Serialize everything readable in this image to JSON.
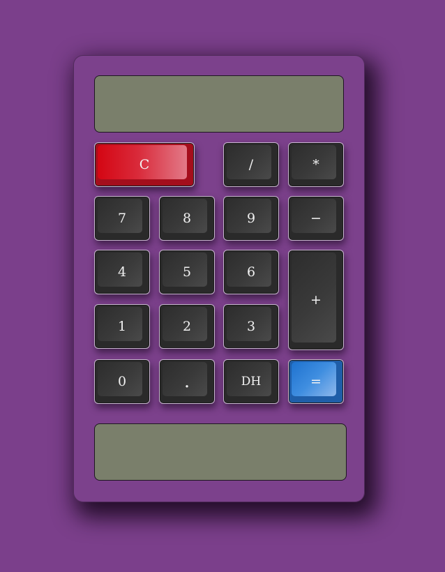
{
  "keys": {
    "clear": "C",
    "divide": "/",
    "multiply": "*",
    "seven": "7",
    "eight": "8",
    "nine": "9",
    "minus": "−",
    "four": "4",
    "five": "5",
    "six": "6",
    "plus": "+",
    "one": "1",
    "two": "2",
    "three": "3",
    "zero": "0",
    "decimal": ".",
    "dh": "DH",
    "equals": "="
  },
  "colors": {
    "background": "#7b3f8b",
    "display": "#7a7f6b",
    "key": "#2a2a2a",
    "clear": "#d40613",
    "equals": "#1e72cf"
  }
}
